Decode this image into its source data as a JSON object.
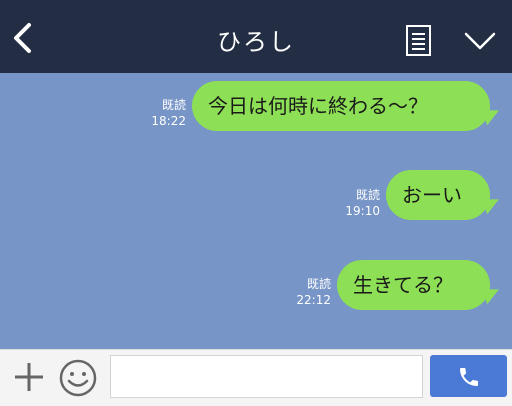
{
  "header": {
    "title": "ひろし",
    "back_icon": "chevron-left-icon",
    "memo_icon": "note-list-icon",
    "menu_icon": "chevron-down-icon"
  },
  "messages": [
    {
      "read_label": "既読",
      "time": "18:22",
      "text": "今日は何時に終わる～？"
    },
    {
      "read_label": "既読",
      "time": "19:10",
      "text": "おーい"
    },
    {
      "read_label": "既読",
      "time": "22:12",
      "text": "生きてる？"
    }
  ],
  "composer": {
    "plus_icon": "plus-icon",
    "emoji_icon": "smiley-icon",
    "input_value": "",
    "call_icon": "phone-icon"
  },
  "colors": {
    "header_bg": "#232e44",
    "chat_bg": "#7795c6",
    "bubble": "#8de055",
    "call_button": "#4a79d6"
  }
}
